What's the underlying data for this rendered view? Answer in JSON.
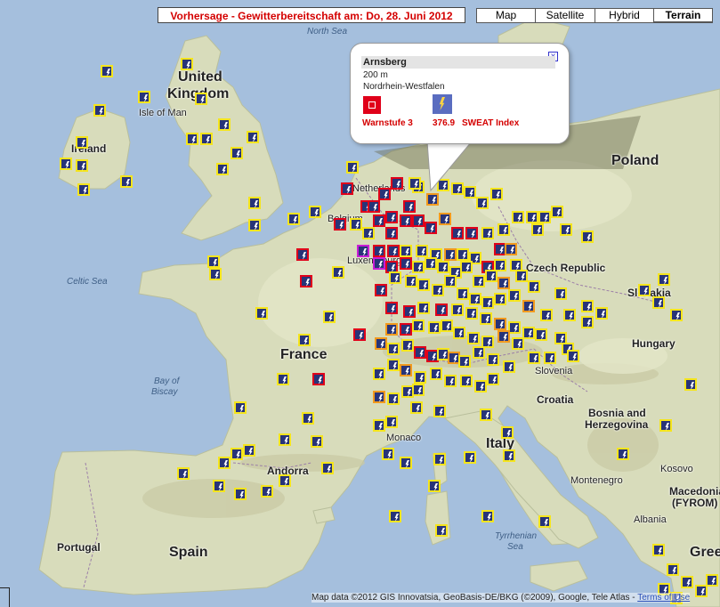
{
  "header": {
    "title": "Vorhersage - Gewitterbereitschaft am: Do, 28. Juni 2012"
  },
  "map_types": [
    {
      "label": "Map",
      "active": false
    },
    {
      "label": "Satellite",
      "active": false
    },
    {
      "label": "Hybrid",
      "active": false
    },
    {
      "label": "Terrain",
      "active": true
    }
  ],
  "popup": {
    "title": "Arnsberg",
    "elevation": "200 m",
    "region": "Nordrhein-Westfalen",
    "warn_label": "Warnstufe 3",
    "sweat_value": "376.9",
    "sweat_label": "SWEAT Index",
    "close": "x"
  },
  "places": {
    "north_sea": "North Sea",
    "united": "United",
    "kingdom": "Kingdom",
    "isle_of_man": "Isle of Man",
    "ireland": "Ireland",
    "netherlands": "Netherlands",
    "belgium": "Belgium",
    "luxembourg": "Luxembourg",
    "poland": "Poland",
    "czech": "Czech Republic",
    "slovakia": "Slovakia",
    "hungary": "Hungary",
    "slovenia": "Slovenia",
    "croatia": "Croatia",
    "bosnia1": "Bosnia and",
    "bosnia2": "Herzegovina",
    "celtic_sea": "Celtic Sea",
    "france": "France",
    "bay1": "Bay of",
    "bay2": "Biscay",
    "monaco": "Monaco",
    "italy": "Italy",
    "montenegro": "Montenegro",
    "kosovo": "Kosovo",
    "macedonia1": "Macedonia",
    "macedonia2": "(FYROM)",
    "albania": "Albania",
    "andorra": "Andorra",
    "portugal": "Portugal",
    "spain": "Spain",
    "tyrrhenian1": "Tyrrhenian",
    "tyrrhenian2": "Sea",
    "greece": "Gree"
  },
  "footer": {
    "attribution": "Map data ©2012 GIS Innovatsia, GeoBasis-DE/BKG (©2009), Google, Tele Atlas - ",
    "terms": "Terms of Use"
  },
  "colors": {
    "sea": "#a5bfdd",
    "land": "#d8dcbb",
    "marker_fill": "#283478",
    "level_1": "#f5e51c",
    "level_2": "#f29a1d",
    "level_3": "#e0001a",
    "level_4": "#c81ed6",
    "title_text": "#d40000"
  }
}
